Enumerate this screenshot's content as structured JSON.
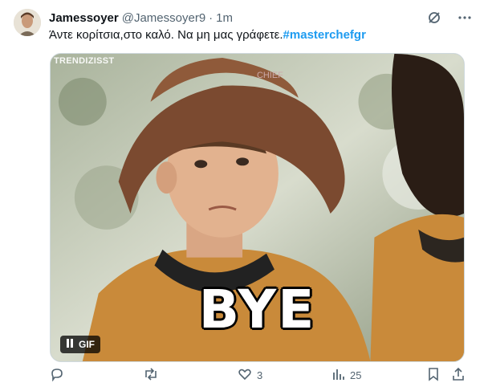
{
  "tweet": {
    "display_name": "Jamessoyer",
    "handle": "@Jamessoyer9",
    "separator": "·",
    "time": "1m",
    "text": "Άντε κορίτσια,στο καλό. Να μη μας γράφετε.",
    "hashtag": "#masterchefgr"
  },
  "media": {
    "watermark": "TRENDIZISST",
    "caption": "BYE",
    "gif_label": "GIF"
  },
  "actions": {
    "replies": "",
    "retweets": "",
    "likes": "3",
    "views": "25"
  },
  "colors": {
    "accent": "#1d9bf0",
    "muted": "#536471"
  }
}
